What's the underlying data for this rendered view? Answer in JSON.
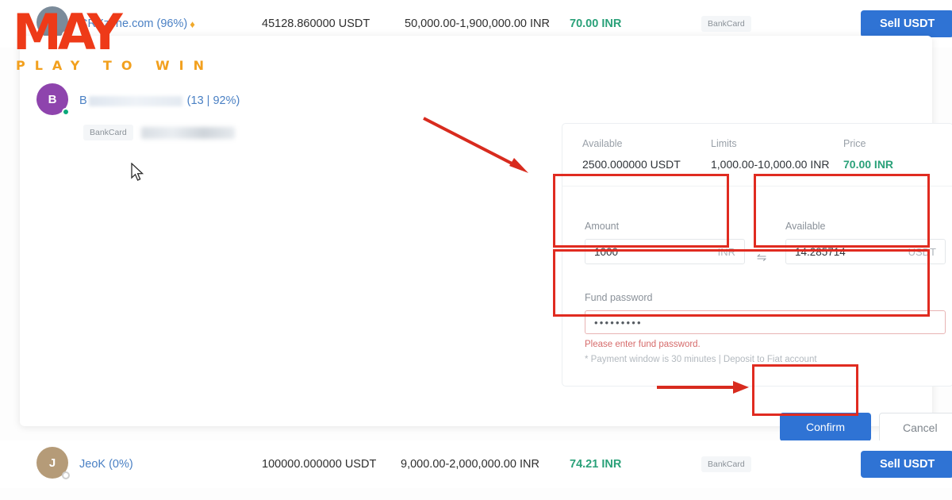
{
  "rows": [
    {
      "avatar_letter": "C",
      "avatar_color": "#7b8b9a",
      "merchant": "CRXzone.com (96%)",
      "gem": "♦",
      "available": "45128.860000 USDT",
      "limits": "50,000.00-1,900,000.00 INR",
      "price": "70.00 INR",
      "payment": "BankCard",
      "action": "Sell USDT"
    },
    {
      "avatar_letter": "J",
      "avatar_color": "#b59b78",
      "merchant": "JeoK (0%)",
      "available": "100000.000000 USDT",
      "limits": "9,000.00-2,000,000.00 INR",
      "price": "74.21 INR",
      "payment": "BankCard",
      "action": "Sell USDT"
    }
  ],
  "expanded": {
    "avatar_letter": "B",
    "avatar_color": "#8e44ad",
    "merchant_prefix": "B",
    "merchant_stats": "(13 | 92%)",
    "payment": "BankCard"
  },
  "order": {
    "summary": {
      "available_label": "Available",
      "available_value": "2500.000000 USDT",
      "limits_label": "Limits",
      "limits_value": "1,000.00-10,000.00 INR",
      "price_label": "Price",
      "price_value": "70.00 INR"
    },
    "amount": {
      "label": "Amount",
      "value": "1000",
      "unit": "INR"
    },
    "swap_icon": "⇋",
    "receive": {
      "label": "Available",
      "value": "14.285714",
      "unit": "USDT"
    },
    "fund_password": {
      "label": "Fund password",
      "value": "•••••••••",
      "error": "Please enter fund password."
    },
    "note": "* Payment window is 30 minutes  |  Deposit to Fiat account",
    "confirm_label": "Confirm",
    "cancel_label": "Cancel"
  },
  "watermark": {
    "title": "MAY",
    "tagline": "PLAY TO WIN"
  },
  "colors": {
    "accent_blue": "#2f73d4",
    "price_green": "#2aa179",
    "highlight_red": "#e02b20",
    "logo_red": "#ee3a18",
    "logo_orange": "#f2a01e"
  }
}
